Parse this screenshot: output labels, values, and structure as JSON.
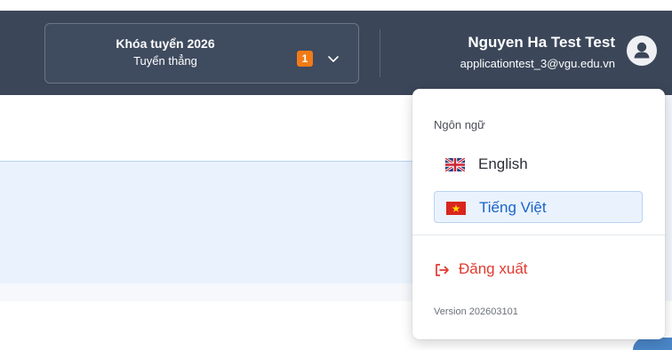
{
  "header": {
    "cohort": {
      "title": "Khóa tuyển 2026",
      "subtitle": "Tuyển thẳng",
      "badge": "1"
    },
    "user": {
      "name": "Nguyen Ha Test Test",
      "email": "applicationtest_3@vgu.edu.vn",
      "avatar_icon": "user-icon"
    }
  },
  "menu": {
    "language_heading": "Ngôn ngữ",
    "languages": [
      {
        "label": "English",
        "flag_icon": "uk-flag-icon",
        "selected": false
      },
      {
        "label": "Tiếng Việt",
        "flag_icon": "vietnam-flag-icon",
        "selected": true
      }
    ],
    "logout_label": "Đăng xuất",
    "logout_icon": "logout-icon",
    "version": "Version 202603101"
  },
  "colors": {
    "header_bg": "#3b4659",
    "badge": "#f37b16",
    "selected_text": "#1b64c8",
    "logout": "#e03a2f"
  }
}
